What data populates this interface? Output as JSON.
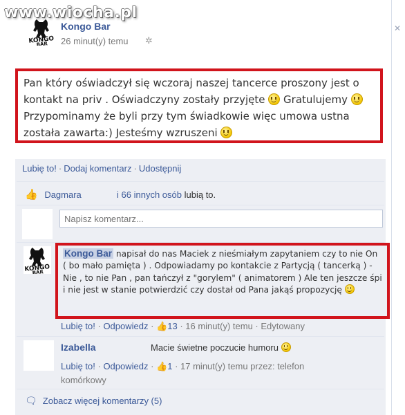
{
  "watermark": "www.wiocha.pl",
  "post": {
    "author": "Kongo Bar",
    "time": "26 minut(y) temu",
    "gear_icon": "gear-icon",
    "text_1": "Pan który oświadczył się wczoraj naszej tancerce proszony jest o kontakt na priv . Oświadczyny zostały przyjęte",
    "text_2": "Gratulujemy",
    "text_3": "Przypominamy że byli przy tym świadkowie więc umowa ustna została zawarta:) Jesteśmy wzruszeni"
  },
  "actions": {
    "like": "Lubię to!",
    "comment": "Dodaj komentarz",
    "share": "Udostępnij"
  },
  "likes": {
    "name": "Dagmara",
    "others": "i 66 innych osób",
    "suffix": "lubią to."
  },
  "comment_input": {
    "placeholder": "Napisz komentarz..."
  },
  "comment1": {
    "author": "Kongo Bar",
    "text": "napisał do nas Maciek z nieśmiałym zapytaniem czy to nie On ( bo mało pamięta ) . Odpowiadamy po kontakcie z Partycją ( tancerką ) - Nie , to nie Pan , pan tańczył z \"gorylem\" ( animatorem ) Ale ten jeszcze śpi i nie jest w stanie potwierdzić czy dostał od Pana jakąś propozycję",
    "like": "Lubię to!",
    "reply": "Odpowiedz",
    "like_count": "13",
    "time": "16 minut(y) temu",
    "edited": "Edytowany"
  },
  "comment2": {
    "author": "Izabella",
    "text": "Macie świetne poczucie humoru",
    "like": "Lubię to!",
    "reply": "Odpowiedz",
    "like_count": "1",
    "time": "17 minut(y) temu przez: telefon",
    "time_cont": "komórkowy"
  },
  "more_comments": "Zobacz więcej komentarzy (5)",
  "colors": {
    "link": "#3b5998",
    "highlight_border": "#d1141c",
    "feed_bg": "#edeff4"
  }
}
